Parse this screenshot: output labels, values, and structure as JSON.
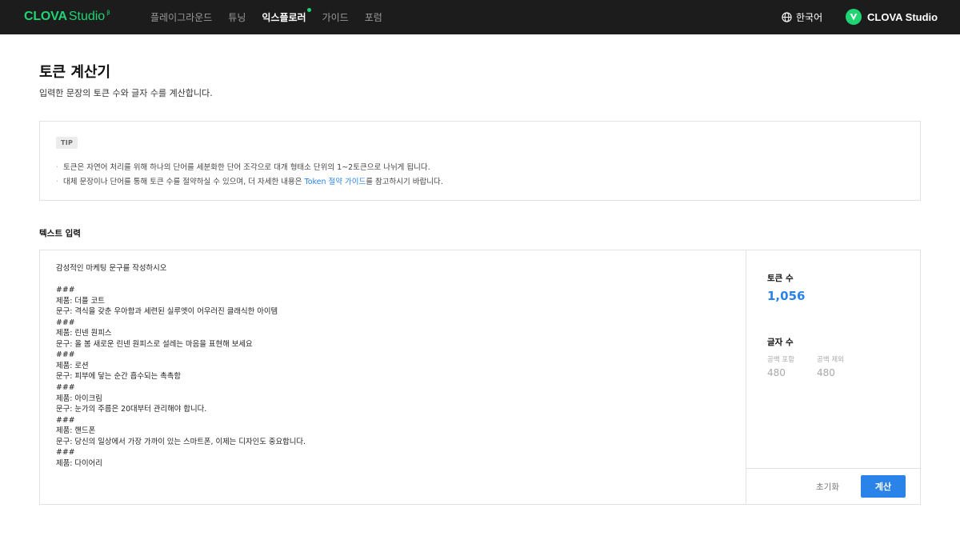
{
  "brand": {
    "logo_main": "CLOVA",
    "logo_sub": "Studio",
    "logo_mark": "β",
    "accent_color": "#1fd473"
  },
  "nav": {
    "items": [
      {
        "label": "플레이그라운드"
      },
      {
        "label": "튜닝"
      },
      {
        "label": "익스플로러",
        "active": true
      },
      {
        "label": "가이드"
      },
      {
        "label": "포럼"
      }
    ],
    "language": "한국어",
    "account": "CLOVA Studio"
  },
  "page": {
    "title": "토큰 계산기",
    "description": "입력한 문장의 토큰 수와 글자 수를 계산합니다."
  },
  "tip": {
    "badge": "TIP",
    "line1": "토큰은 자연어 처리를 위해 하나의 단어를 세분화한 단어 조각으로 대개 형태소 단위의 1~2토큰으로 나뉘게 됩니다.",
    "line2_before": "대체 문장이나 단어를 통해 토큰 수를 절약하실 수 있으며, 더 자세한 내용은 ",
    "line2_link": "Token 절약 가이드",
    "line2_after": "를 참고하시기 바랍니다.",
    "link_color": "#2a83e8"
  },
  "input_section": {
    "label": "텍스트 입력",
    "text": "감성적인 마케팅 문구를 작성하시오\n\n###\n제품: 더플 코트\n문구: 격식을 갖춘 우아함과 세련된 실루엣이 어우러진 클래식한 아이템\n###\n제품: 린넨 원피스\n문구: 올 봄 새로운 린넨 원피스로 설레는 마음을 표현해 보세요\n###\n제품: 로션\n문구: 피부에 닿는 순간 흡수되는 촉촉함\n###\n제품: 아이크림\n문구: 눈가의 주름은 20대부터 관리해야 합니다.\n###\n제품: 핸드폰\n문구: 당신의 일상에서 가장 가까이 있는 스마트폰, 이제는 디자인도 중요합니다.\n###\n제품: 다이어리"
  },
  "stats": {
    "tokens_label": "토큰 수",
    "tokens_value": "1,056",
    "chars_label": "글자 수",
    "with_spaces_label": "공백 포함",
    "with_spaces_value": "480",
    "without_spaces_label": "공백 제외",
    "without_spaces_value": "480"
  },
  "actions": {
    "reset_label": "초기화",
    "calculate_label": "계산"
  }
}
